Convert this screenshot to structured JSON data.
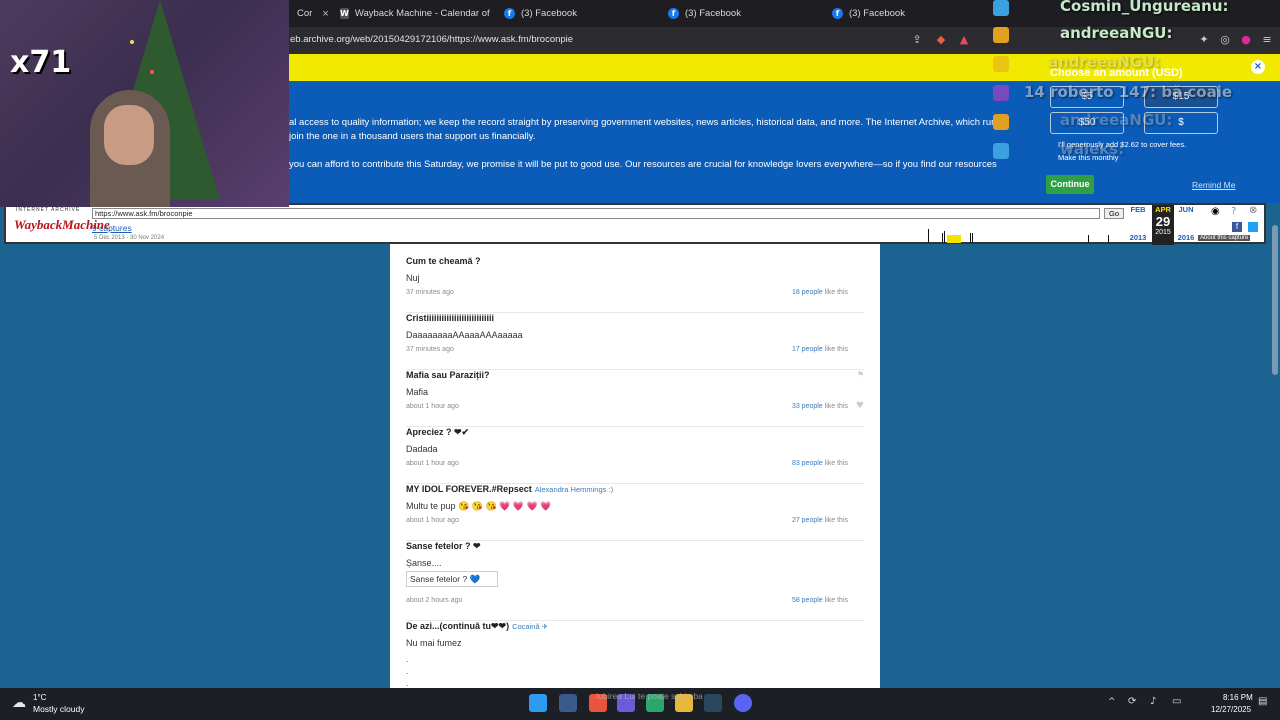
{
  "browser": {
    "tabs": [
      {
        "label": "Cor",
        "icon": "wayback-icon"
      },
      {
        "label": "Wayback Machine - Calendar of http:",
        "icon": "wayback-icon"
      },
      {
        "label": "(3) Facebook",
        "icon": "facebook-icon"
      },
      {
        "label": "(3) Facebook",
        "icon": "facebook-icon"
      },
      {
        "label": "(3) Facebook",
        "icon": "facebook-icon"
      }
    ],
    "url": "eb.archive.org/web/20150429172106/https://www.ask.fm/broconpie"
  },
  "banner": {
    "line1": "al access to quality information; we keep the record straight by preserving government websites, news articles, historical data, and more. The Internet Archive, which runs",
    "line2": "join the one in a thousand users that support us financially.",
    "line3": "you can afford to contribute this Saturday, we promise it will be put to good use. Our resources are crucial for knowledge lovers everywhere—so if you find our resources",
    "choose_amount": "Choose an amount (USD)",
    "amounts": [
      "$5",
      "$15",
      "$50",
      "$"
    ],
    "fee_text": "I'll generously add $2.62 to cover fees.",
    "monthly_text": "Make this monthly",
    "continue_label": "Continue",
    "remind_label": "Remind Me"
  },
  "wayback": {
    "brand_top": "INTERNET ARCHIVE",
    "brand": "WaybackMachine",
    "url_value": "https://www.ask.fm/broconpie",
    "go_label": "Go",
    "captures": "9 captures",
    "range": "5 Dec 2013 - 30 Nov 2024",
    "months": [
      "FEB",
      "APR",
      "JUN"
    ],
    "day": "29",
    "years": [
      "2013",
      "2015",
      "2016"
    ],
    "about": "About this capture"
  },
  "posts": [
    {
      "question": "Cum te cheamă ?",
      "answer": "Nuj",
      "time": "37 minutes ago",
      "likes": "18 people",
      "likes_suffix": "like this"
    },
    {
      "question": "Cristiiiiiiiiiiiiiiiiiiiiiiiiiii",
      "answer": "DaaaaaaaaAAaaaAAAaaaaa",
      "time": "37 minutes ago",
      "likes": "17 people",
      "likes_suffix": "like this"
    },
    {
      "question": "Mafia sau Paraziții?",
      "answer": "Mafia",
      "time": "about 1 hour ago",
      "likes": "33 people",
      "likes_suffix": "like this"
    },
    {
      "question": "Apreciez ? ❤✔",
      "answer": "Dadada",
      "time": "about 1 hour ago",
      "likes": "83 people",
      "likes_suffix": "like this"
    },
    {
      "question": "MY IDOL FOREVER.#Repsect",
      "by": "Alexandra Hemmings :)",
      "answer": "Multu te pup 😘 😘 😘 💗 💗 💗 💗",
      "time": "about 1 hour ago",
      "likes": "27 people",
      "likes_suffix": "like this"
    },
    {
      "question": "Sanse fetelor ? ❤",
      "answer": "Șanse....",
      "image_alt": "Sanse fetelor ? 💙",
      "time": "about 2 hours ago",
      "likes": "58 people",
      "likes_suffix": "like this"
    },
    {
      "question": "De azi...(continuă tu❤❤)",
      "by": "Cocaină ✈",
      "answer": "Nu mai fumez"
    }
  ],
  "overlay": {
    "multiplier": "x71",
    "chat": [
      "Cosmin_Ungureanu:",
      "andreeaNGU:",
      "andreeaNGU:",
      "14 roberto 147: bă coaie",
      "andreeaNGU:",
      "waleks:"
    ]
  },
  "taskbar": {
    "temp": "1°C",
    "weather": "Mostly cloudy",
    "tip": "Iubirea Lui te poate schimba",
    "time": "8:16 PM",
    "date": "12/27/2025"
  },
  "colors": {
    "page_bg": "#1b6491",
    "banner_blue": "#0b5cb8",
    "banner_yellow": "#f2e900",
    "link": "#3a7bbf"
  }
}
